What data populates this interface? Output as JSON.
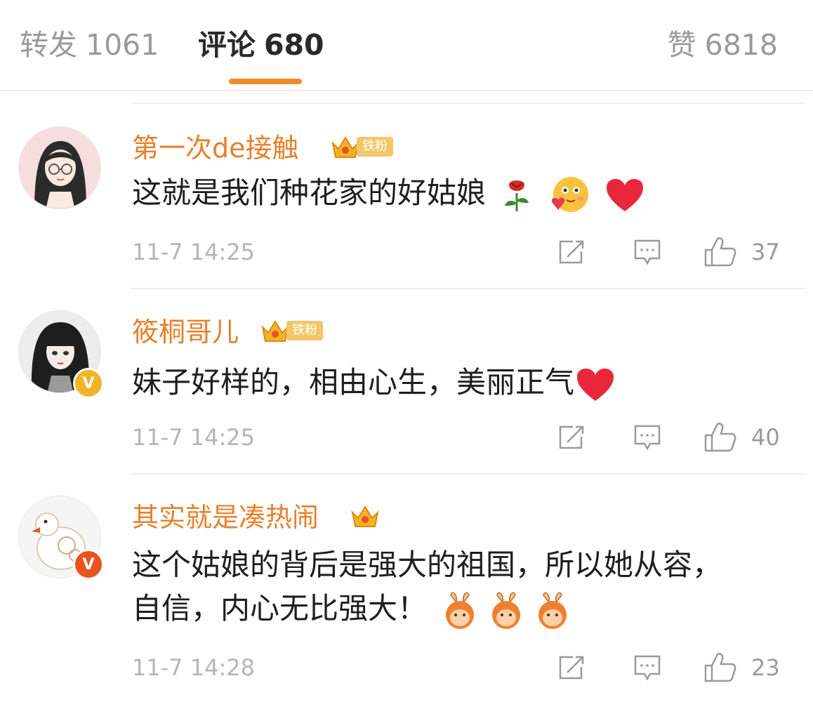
{
  "tabs": {
    "repost": {
      "label": "转发",
      "count": "1061"
    },
    "comments": {
      "label": "评论",
      "count": "680"
    },
    "likes": {
      "label": "赞",
      "count": "6818"
    }
  },
  "comments": [
    {
      "username": "第一次de接触",
      "badge": "铁粉",
      "text": "这就是我们种花家的好姑娘",
      "emojis": [
        "rose-icon",
        "blushing-hug-face-icon",
        "red-heart-icon"
      ],
      "time": "11-7 14:25",
      "likes": "37"
    },
    {
      "username": "筱桐哥儿",
      "badge": "铁粉",
      "verified": "V",
      "text": "妹子好样的，相由心生，美丽正气",
      "emojis": [
        "red-heart-icon"
      ],
      "time": "11-7 14:25",
      "likes": "40"
    },
    {
      "username": "其实就是凑热闹",
      "verified": "V",
      "text": "这个姑娘的背后是强大的祖国，所以她从容，自信，内心无比强大！",
      "emojis": [
        "bunny-ears-icon",
        "bunny-ears-icon",
        "bunny-ears-icon"
      ],
      "time": "11-7 14:28",
      "likes": "23"
    }
  ],
  "colors": {
    "accent": "#f08a2c",
    "username": "#e8802a",
    "muted": "#9a9a9a",
    "verified_gold": "#f2b32a",
    "verified_red": "#e8531f"
  }
}
